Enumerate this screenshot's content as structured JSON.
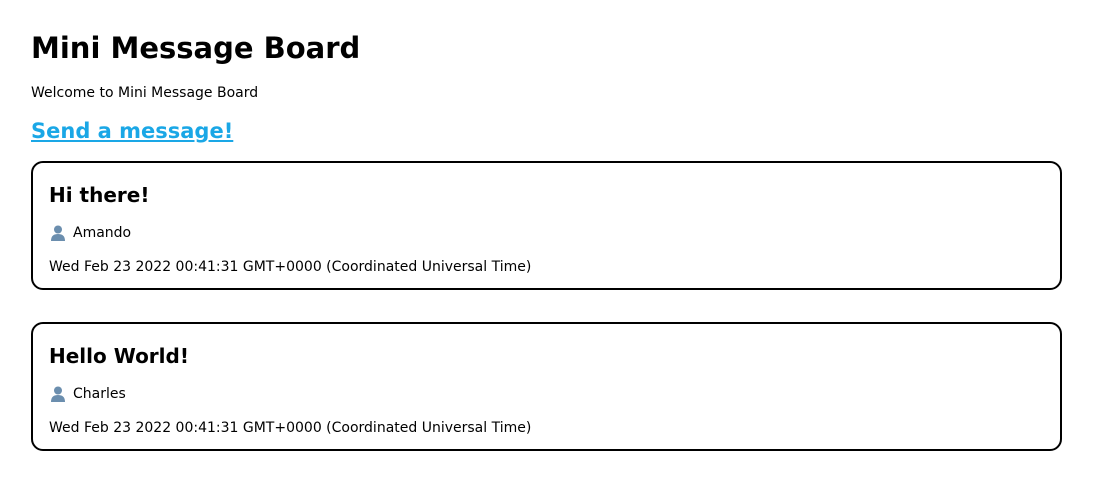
{
  "header": {
    "title": "Mini Message Board",
    "welcome": "Welcome to Mini Message Board",
    "send_link": "Send a message!"
  },
  "colors": {
    "link": "#1aa7e6",
    "card_border": "#000000",
    "user_icon": "#6b8eae"
  },
  "messages": [
    {
      "title": "Hi there!",
      "author_icon": "user-icon",
      "author": "Amando",
      "date": "Wed Feb 23 2022 00:41:31 GMT+0000 (Coordinated Universal Time)"
    },
    {
      "title": "Hello World!",
      "author_icon": "user-icon",
      "author": "Charles",
      "date": "Wed Feb 23 2022 00:41:31 GMT+0000 (Coordinated Universal Time)"
    }
  ]
}
